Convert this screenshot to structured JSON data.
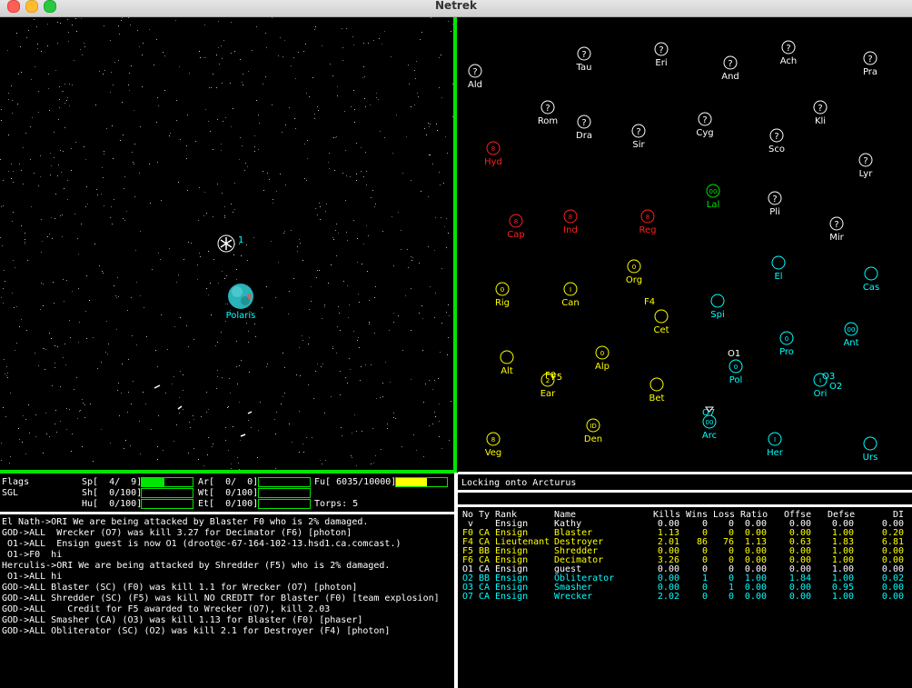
{
  "window": {
    "title": "Netrek"
  },
  "colors": {
    "fed": "#ffff00",
    "rom": "#ff2020",
    "kli": "#00e600",
    "ori": "#00ffff",
    "ind": "#ffffff",
    "grid": "#00e600",
    "fuel": "#ffff00",
    "gauge": "#00e600"
  },
  "tactical": {
    "planet": {
      "name": "Polaris",
      "team": "ori"
    },
    "ship": {
      "label": "1"
    }
  },
  "galaxy": {
    "planets": [
      {
        "name": "Ald",
        "team": "ind",
        "unknown": true
      },
      {
        "name": "Tau",
        "team": "ind",
        "unknown": true
      },
      {
        "name": "Eri",
        "team": "ind",
        "unknown": true
      },
      {
        "name": "And",
        "team": "ind",
        "unknown": true
      },
      {
        "name": "Ach",
        "team": "ind",
        "unknown": true
      },
      {
        "name": "Pra",
        "team": "ind",
        "unknown": true
      },
      {
        "name": "Rom",
        "team": "ind",
        "unknown": true
      },
      {
        "name": "Dra",
        "team": "ind",
        "unknown": true
      },
      {
        "name": "Sir",
        "team": "ind",
        "unknown": true
      },
      {
        "name": "Cyg",
        "team": "ind",
        "unknown": true
      },
      {
        "name": "Kli",
        "team": "ind",
        "unknown": true
      },
      {
        "name": "Sco",
        "team": "ind",
        "unknown": true
      },
      {
        "name": "Lyr",
        "team": "ind",
        "unknown": true
      },
      {
        "name": "Pli",
        "team": "ind",
        "unknown": true
      },
      {
        "name": "Mir",
        "team": "ind",
        "unknown": true
      },
      {
        "name": "Hyd",
        "team": "rom",
        "glyph": "8"
      },
      {
        "name": "Cap",
        "team": "rom",
        "glyph": "8"
      },
      {
        "name": "Ind",
        "team": "rom",
        "glyph": "8"
      },
      {
        "name": "Reg",
        "team": "rom",
        "glyph": "8"
      },
      {
        "name": "Lal",
        "team": "kli",
        "glyph": "00"
      },
      {
        "name": "Rig",
        "team": "fed",
        "glyph": "0"
      },
      {
        "name": "Can",
        "team": "fed",
        "glyph": "I"
      },
      {
        "name": "Org",
        "team": "fed",
        "glyph": "0"
      },
      {
        "name": "Cet",
        "team": "fed",
        "glyph": ""
      },
      {
        "name": "Alt",
        "team": "fed",
        "glyph": ""
      },
      {
        "name": "Alp",
        "team": "fed",
        "glyph": "0"
      },
      {
        "name": "Ear",
        "team": "fed",
        "glyph": "2"
      },
      {
        "name": "Bet",
        "team": "fed",
        "glyph": ""
      },
      {
        "name": "Veg",
        "team": "fed",
        "glyph": "8"
      },
      {
        "name": "Den",
        "team": "fed",
        "glyph": "ID"
      },
      {
        "name": "El",
        "team": "ori",
        "glyph": ""
      },
      {
        "name": "Cas",
        "team": "ori",
        "glyph": ""
      },
      {
        "name": "Spi",
        "team": "ori",
        "glyph": ""
      },
      {
        "name": "Pro",
        "team": "ori",
        "glyph": "0"
      },
      {
        "name": "Ant",
        "team": "ori",
        "glyph": "00"
      },
      {
        "name": "Pol",
        "team": "ori",
        "glyph": "0"
      },
      {
        "name": "Ori",
        "team": "ori",
        "glyph": "I"
      },
      {
        "name": "Arc",
        "team": "ori",
        "glyph": "00"
      },
      {
        "name": "Her",
        "team": "ori",
        "glyph": "I"
      },
      {
        "name": "Urs",
        "team": "ori",
        "glyph": ""
      }
    ],
    "ships": [
      {
        "label": "F4",
        "team": "fed"
      },
      {
        "label": "F0",
        "team": "fed"
      },
      {
        "label": "F5",
        "team": "fed"
      },
      {
        "label": "O1",
        "team": "ind"
      },
      {
        "label": "O3",
        "team": "ori"
      },
      {
        "label": "O2",
        "team": "ori"
      },
      {
        "label": "O7",
        "team": "ori"
      }
    ]
  },
  "status": {
    "flags_label": "Flags",
    "flags_value": "SGL",
    "speed": "Sp[  4/  9]",
    "shields": "Sh[  0/100]",
    "hull": "Hu[  0/100]",
    "armies": "Ar[  0/  0]",
    "weapon_temp": "Wt[  0/100]",
    "engine_temp": "Et[  0/100]",
    "fuel": "Fu[ 6035/10000]",
    "torps": "Torps: 5",
    "gauges": {
      "speed": 0.44,
      "shields": 0,
      "hull": 0,
      "armies": 0,
      "weapon_temp": 0,
      "engine_temp": 0,
      "fuel": 0.6035
    }
  },
  "lock_message": "Locking onto Arcturus",
  "messages": [
    "El Nath->ORI We are being attacked by Blaster F0 who is 2% damaged.",
    "GOD->ALL  Wrecker (O7) was kill 3.27 for Decimator (F6) [photon]",
    " O1->ALL  Ensign guest is now O1 (droot@c-67-164-102-13.hsd1.ca.comcast.)",
    " O1->F0  hi",
    "Herculis->ORI We are being attacked by Shredder (F5) who is 2% damaged.",
    " O1->ALL hi",
    "GOD->ALL Blaster (SC) (F0) was kill 1.1 for Wrecker (O7) [photon]",
    "GOD->ALL Shredder (SC) (F5) was kill NO CREDIT for Blaster (F0) [team explosion]",
    "GOD->ALL    Credit for F5 awarded to Wrecker (O7), kill 2.03",
    "GOD->ALL Smasher (CA) (O3) was kill 1.13 for Blaster (F0) [phaser]",
    "GOD->ALL Obliterator (SC) (O2) was kill 2.1 for Destroyer (F4) [photon]"
  ],
  "player_list": {
    "headers": [
      "No",
      "Ty",
      "Rank",
      "Name",
      "Kills",
      "Wins",
      "Loss",
      "Ratio",
      "Offse",
      "Defse",
      "DI"
    ],
    "rows": [
      {
        "team": "ind",
        "cells": [
          " v",
          "",
          "Ensign",
          "Kathy",
          "0.00",
          "0",
          "0",
          "0.00",
          "0.00",
          "0.00",
          "0.00"
        ]
      },
      {
        "team": "fed",
        "cells": [
          "F0",
          "CA",
          "Ensign",
          "Blaster",
          "1.13",
          "0",
          "0",
          "0.00",
          "0.00",
          "1.00",
          "0.20"
        ]
      },
      {
        "team": "fed",
        "cells": [
          "F4",
          "CA",
          "Lieutenant",
          "Destroyer",
          "2.01",
          "86",
          "76",
          "1.13",
          "0.63",
          "1.83",
          "6.81"
        ]
      },
      {
        "team": "fed",
        "cells": [
          "F5",
          "BB",
          "Ensign",
          "Shredder",
          "0.00",
          "0",
          "0",
          "0.00",
          "0.00",
          "1.00",
          "0.00"
        ]
      },
      {
        "team": "fed",
        "cells": [
          "F6",
          "CA",
          "Ensign",
          "Decimator",
          "3.26",
          "0",
          "0",
          "0.00",
          "0.00",
          "1.00",
          "0.00"
        ]
      },
      {
        "team": "ind",
        "cells": [
          "O1",
          "CA",
          "Ensign",
          "guest",
          "0.00",
          "0",
          "0",
          "0.00",
          "0.00",
          "1.00",
          "0.00"
        ]
      },
      {
        "team": "ori",
        "cells": [
          "O2",
          "BB",
          "Ensign",
          "Obliterator",
          "0.00",
          "1",
          "0",
          "1.00",
          "1.84",
          "1.00",
          "0.02"
        ]
      },
      {
        "team": "ori",
        "cells": [
          "O3",
          "CA",
          "Ensign",
          "Smasher",
          "0.00",
          "0",
          "1",
          "0.00",
          "0.00",
          "0.95",
          "0.00"
        ]
      },
      {
        "team": "ori",
        "cells": [
          "O7",
          "CA",
          "Ensign",
          "Wrecker",
          "2.02",
          "0",
          "0",
          "0.00",
          "0.00",
          "1.00",
          "0.00"
        ]
      }
    ]
  }
}
